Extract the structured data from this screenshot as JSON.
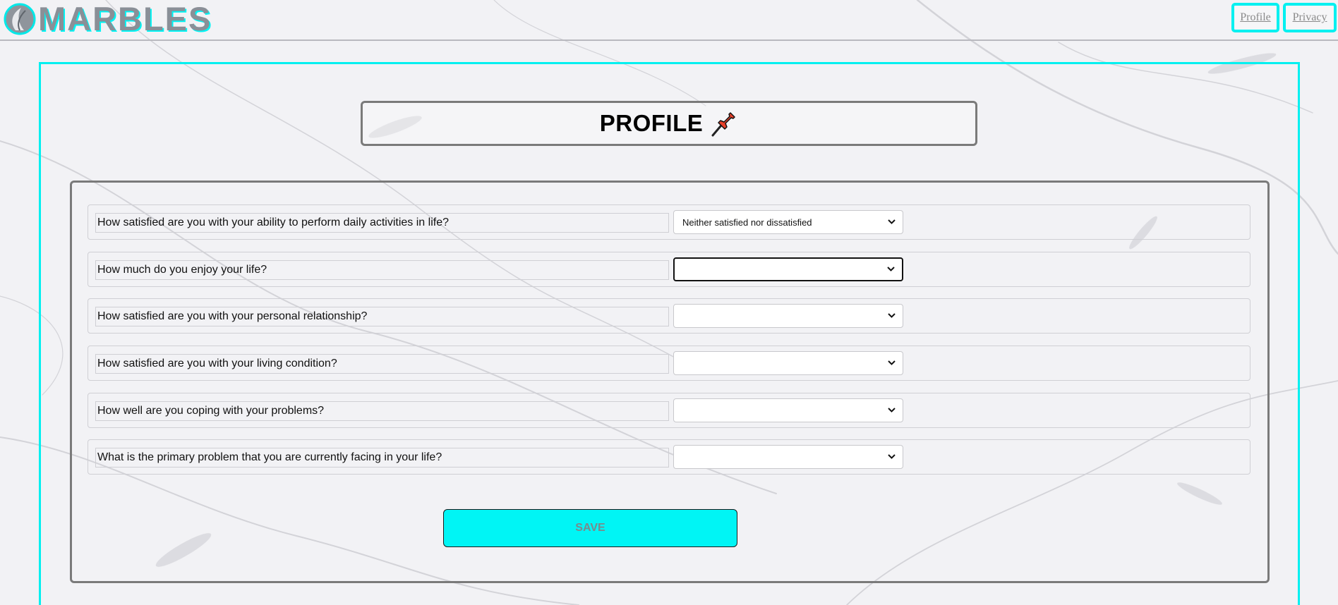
{
  "app": {
    "logo_text": "MARBLES"
  },
  "nav": {
    "profile_label": "Profile",
    "privacy_label": "Privacy"
  },
  "page": {
    "title": "PROFILE"
  },
  "questions": [
    {
      "label": "How satisfied are you with your ability to perform daily activities in life?",
      "selected": "Neither satisfied nor dissatisfied"
    },
    {
      "label": "How much do you enjoy your life?",
      "selected": ""
    },
    {
      "label": "How satisfied are you with your personal relationship?",
      "selected": ""
    },
    {
      "label": "How satisfied are you with your living condition?",
      "selected": ""
    },
    {
      "label": "How well are you coping with your problems?",
      "selected": ""
    },
    {
      "label": "What is the primary problem that you are currently facing in your life?",
      "selected": ""
    }
  ],
  "form": {
    "save_label": "SAVE"
  },
  "colors": {
    "accent": "#00f0f0",
    "border": "#7a7a7a",
    "background": "#f3f3f6"
  }
}
